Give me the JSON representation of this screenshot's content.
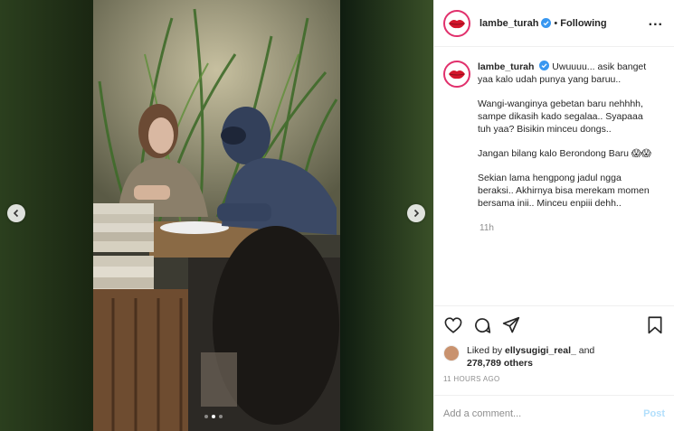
{
  "post": {
    "username": "lambe_turah",
    "follow_separator": "•",
    "follow_label": "Following",
    "more_label": "...",
    "caption": {
      "username": "lambe_turah",
      "paragraphs": [
        "Uwuuuu... asik banget yaa kalo udah punya yang baruu..",
        "Wangi-wanginya gebetan baru nehhhh, sampe dikasih kado segalaa.. Syapaaa tuh yaa? Bisikin minceu dongs..",
        "Jangan bilang kalo Berondong Baru 😱😱",
        "Sekian lama hengpong jadul ngga beraksi.. Akhirnya bisa merekam momen bersama inii.. Minceu enpiii dehh.."
      ],
      "time": "11h"
    },
    "likes": {
      "prefix": "Liked by",
      "liker": "ellysugigi_real_",
      "conjunction": "and",
      "count": "278,789 others"
    },
    "posted_ago": "11 HOURS AGO",
    "comment": {
      "placeholder": "Add a comment...",
      "post_label": "Post"
    }
  },
  "carousel": {
    "prev_icon": "chevron-left-icon",
    "next_icon": "chevron-right-icon",
    "dot_count": 3,
    "active_dot": 2
  },
  "colors": {
    "story_ring": "#e1306c",
    "verified": "#3897f0",
    "post_disabled": "#b2dffc",
    "muted": "#8e8e8e"
  }
}
